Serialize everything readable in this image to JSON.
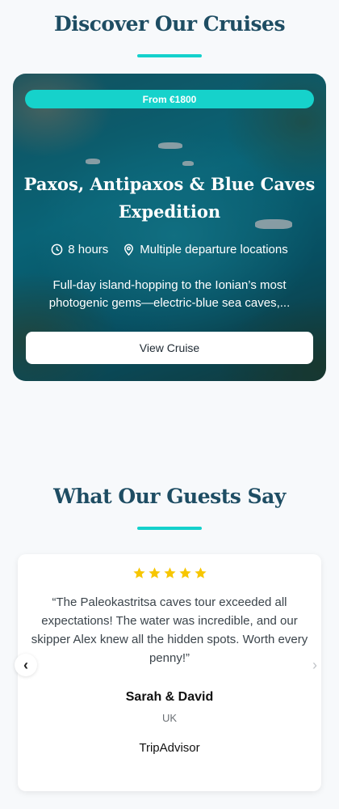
{
  "cruises_section": {
    "title": "Discover Our Cruises",
    "accent_color": "#14d1cc",
    "card": {
      "price_label": "From €1800",
      "title": "Paxos, Antipaxos & Blue Caves Expedition",
      "duration": "8 hours",
      "location": "Multiple departure locations",
      "description_line1": "Full-day island-hopping to the Ionian’s most",
      "description_line2": "photogenic gems—electric-blue sea caves,...",
      "button_label": "View Cruise",
      "icons": {
        "duration": "clock-icon",
        "location": "map-pin-icon"
      }
    }
  },
  "reviews_section": {
    "title": "What Our Guests Say",
    "review": {
      "rating": 5,
      "star_color": "#f7c600",
      "quote": "“The Paleokastritsa caves tour exceeded all expectations! The water was incredible, and our skipper Alex knew all the hidden spots. Worth every penny!”",
      "name": "Sarah & David",
      "country": "UK",
      "source": "TripAdvisor"
    },
    "nav": {
      "prev_icon": "chevron-left-icon",
      "next_icon": "chevron-right-icon"
    }
  }
}
